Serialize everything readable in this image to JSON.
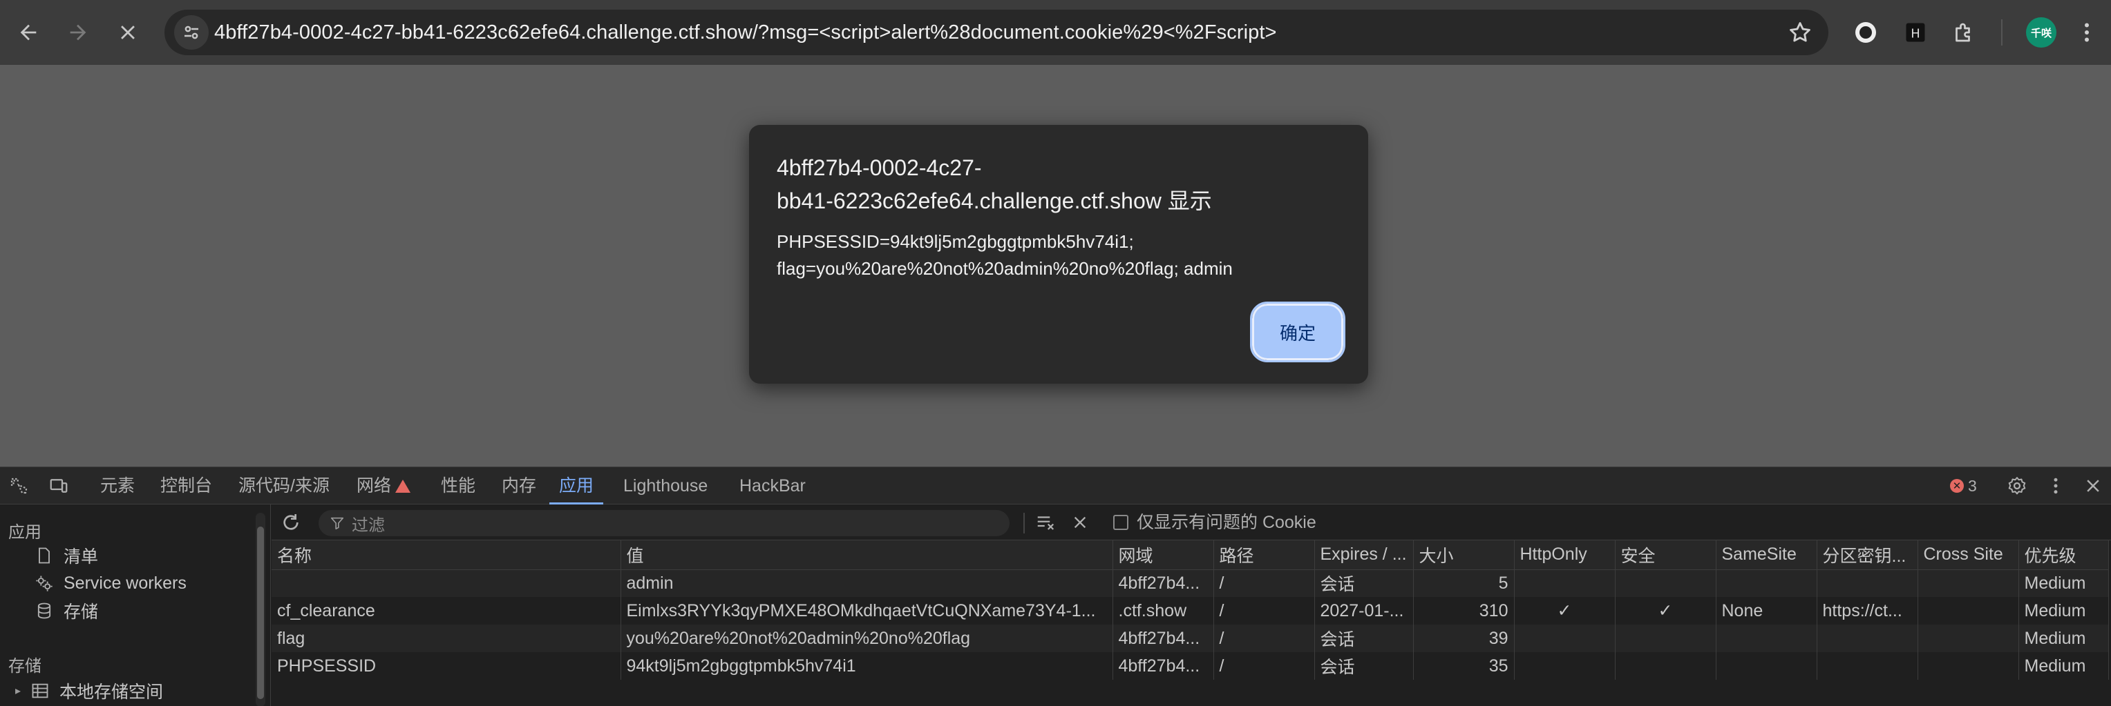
{
  "browser": {
    "url": "4bff27b4-0002-4c27-bb41-6223c62efe64.challenge.ctf.show/?msg=<script>alert%28document.cookie%29<%2Fscript>",
    "avatar_text": "千咲"
  },
  "dialog": {
    "title_line1": "4bff27b4-0002-4c27-",
    "title_line2": "bb41-6223c62efe64.challenge.ctf.show 显示",
    "message_line1": "PHPSESSID=94kt9lj5m2gbggtpmbk5hv74i1;",
    "message_line2": "flag=you%20are%20not%20admin%20no%20flag; admin",
    "ok_label": "确定"
  },
  "devtools": {
    "tabs": [
      "元素",
      "控制台",
      "源代码/来源",
      "网络",
      "性能",
      "内存",
      "应用",
      "Lighthouse",
      "HackBar"
    ],
    "active_tab": "应用",
    "error_count": "3",
    "sidebar": {
      "section1": "应用",
      "items": [
        "清单",
        "Service workers",
        "存储"
      ],
      "section2": "存储",
      "storage_items": [
        "本地存储空间"
      ]
    },
    "filter": {
      "placeholder": "过滤",
      "only_issues_label": "仅显示有问题的 Cookie"
    },
    "columns": [
      "名称",
      "值",
      "网域",
      "路径",
      "Expires / ...",
      "大小",
      "HttpOnly",
      "安全",
      "SameSite",
      "分区密钥...",
      "Cross Site",
      "优先级"
    ],
    "rows": [
      {
        "name": "",
        "value": "admin",
        "domain": "4bff27b4...",
        "path": "/",
        "expires": "会话",
        "size": "5",
        "httponly": "",
        "secure": "",
        "samesite": "",
        "partition": "",
        "crosssite": "",
        "priority": "Medium"
      },
      {
        "name": "cf_clearance",
        "value": "Eimlxs3RYYk3qyPMXE48OMkdhqaetVtCuQNXame73Y4-1...",
        "domain": ".ctf.show",
        "path": "/",
        "expires": "2027-01-...",
        "size": "310",
        "httponly": "✓",
        "secure": "✓",
        "samesite": "None",
        "partition": "https://ct...",
        "crosssite": "",
        "priority": "Medium"
      },
      {
        "name": "flag",
        "value": "you%20are%20not%20admin%20no%20flag",
        "domain": "4bff27b4...",
        "path": "/",
        "expires": "会话",
        "size": "39",
        "httponly": "",
        "secure": "",
        "samesite": "",
        "partition": "",
        "crosssite": "",
        "priority": "Medium"
      },
      {
        "name": "PHPSESSID",
        "value": "94kt9lj5m2gbggtpmbk5hv74i1",
        "domain": "4bff27b4...",
        "path": "/",
        "expires": "会话",
        "size": "35",
        "httponly": "",
        "secure": "",
        "samesite": "",
        "partition": "",
        "crosssite": "",
        "priority": "Medium"
      }
    ]
  }
}
